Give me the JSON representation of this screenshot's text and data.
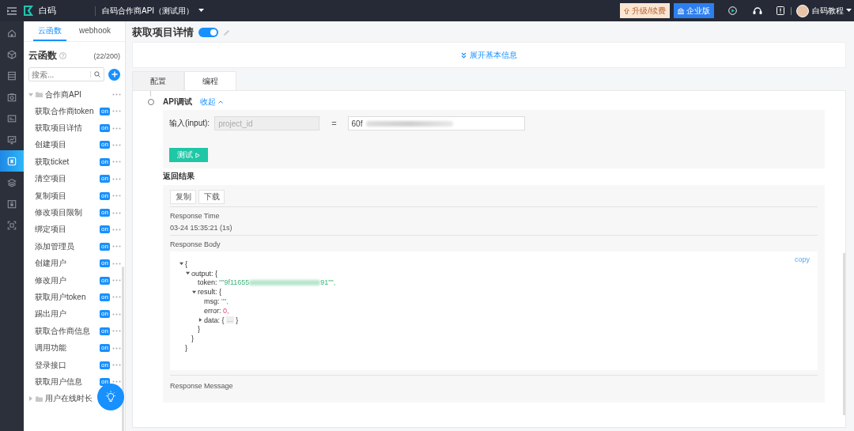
{
  "topbar": {
    "logo_text": "白码",
    "project": "白码合作商API（测试用）",
    "upgrade": "升级/续费",
    "enterprise": "企业版",
    "user": "白码教程"
  },
  "rail": [
    {
      "kind": "home",
      "selected": false
    },
    {
      "kind": "cube",
      "selected": false
    },
    {
      "kind": "database",
      "selected": false
    },
    {
      "kind": "camera",
      "selected": false
    },
    {
      "kind": "card",
      "selected": false
    },
    {
      "kind": "monitor",
      "selected": false
    },
    {
      "kind": "code",
      "selected": true
    },
    {
      "kind": "layers",
      "selected": false
    },
    {
      "kind": "lock",
      "selected": false
    },
    {
      "kind": "scan",
      "selected": false
    }
  ],
  "sidebar": {
    "tabs": [
      {
        "label": "云函数",
        "selected": true
      },
      {
        "label": "webhook",
        "selected": false
      }
    ],
    "title": "云函数",
    "count": "(22/200)",
    "search_placeholder": "搜索...",
    "tree": [
      {
        "label": "合作商API",
        "expanded": true,
        "children": [
          {
            "label": "获取合作商token",
            "badge": "on"
          },
          {
            "label": "获取项目详情",
            "badge": "on"
          },
          {
            "label": "创建项目",
            "badge": "on"
          },
          {
            "label": "获取ticket",
            "badge": "on"
          },
          {
            "label": "清空项目",
            "badge": "on"
          },
          {
            "label": "复制项目",
            "badge": "on"
          },
          {
            "label": "修改项目限制",
            "badge": "on"
          },
          {
            "label": "绑定项目",
            "badge": "on"
          },
          {
            "label": "添加管理员",
            "badge": "on"
          },
          {
            "label": "创建用户",
            "badge": "on"
          },
          {
            "label": "修改用户",
            "badge": "on"
          },
          {
            "label": "获取用户token",
            "badge": "on"
          },
          {
            "label": "踢出用户",
            "badge": "on"
          },
          {
            "label": "获取合作商信息",
            "badge": "on"
          },
          {
            "label": "调用功能",
            "badge": "on"
          },
          {
            "label": "登录接口",
            "badge": "on"
          },
          {
            "label": "获取用户信息",
            "badge": "on"
          }
        ]
      },
      {
        "label": "用户在线时长",
        "expanded": false
      }
    ]
  },
  "main": {
    "title": "获取项目详情",
    "enabled": true,
    "expand_link": "展开基本信息",
    "tabs": [
      {
        "label": "配置",
        "selected": false
      },
      {
        "label": "编程",
        "selected": true
      }
    ],
    "api_test": {
      "label": "API调试",
      "collapse": "收起",
      "input_label": "输入(input):",
      "param": {
        "value": "project_id",
        "disabled": true
      },
      "equals": "=",
      "value": "60f",
      "value_redacted": true,
      "run_button": "测试"
    },
    "result": {
      "label": "返回结果",
      "buttons": [
        "复制",
        "下载"
      ],
      "time_label": "Response Time",
      "time_value": "03-24 15:35:21 (1s)",
      "body_label": "Response Body",
      "copy": "copy",
      "json": {
        "open": "{",
        "close": "}",
        "expanded": true,
        "children": [
          {
            "key": "output:",
            "open": "{",
            "close": "}",
            "expanded": true,
            "children": [
              {
                "key": "token:",
                "value": "\"\"9f11655",
                "redacted": true,
                "value_end": "91\"\",",
                "kind": "string"
              },
              {
                "key": "result:",
                "open": "{",
                "close": "}",
                "expanded": true,
                "children": [
                  {
                    "key": "msg:",
                    "value": "\"\",",
                    "kind": "string"
                  },
                  {
                    "key": "error:",
                    "value": "0,",
                    "kind": "number"
                  },
                  {
                    "key": "data:",
                    "open": "{",
                    "close": "}",
                    "expanded": false,
                    "ellipsis": "..."
                  }
                ]
              }
            ]
          }
        ]
      },
      "message_label": "Response Message"
    }
  }
}
